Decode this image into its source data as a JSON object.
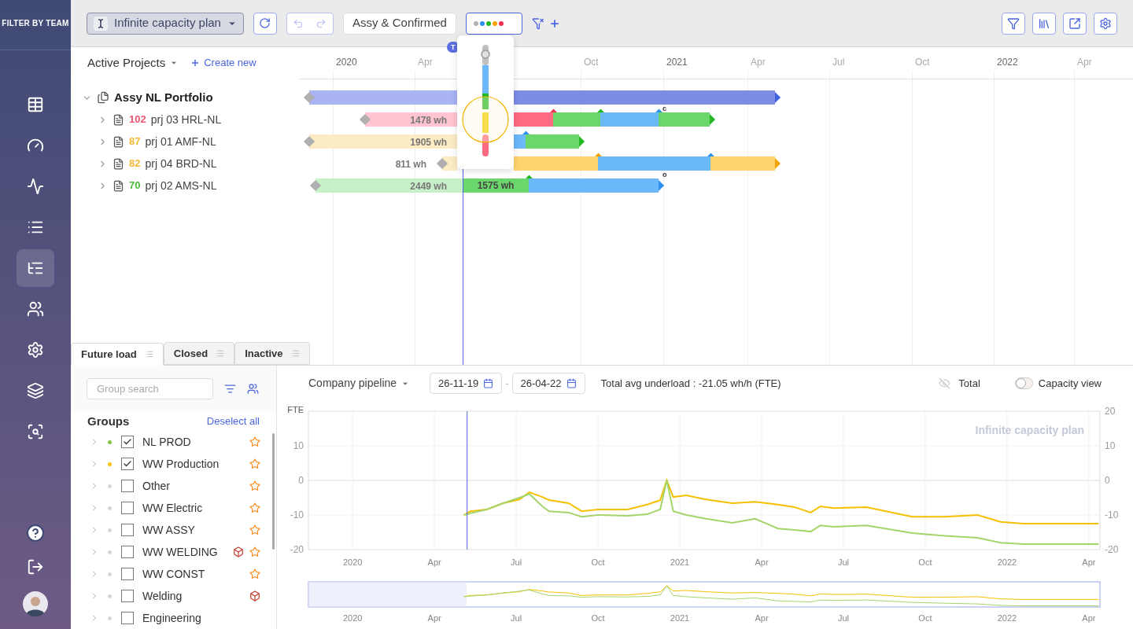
{
  "sidebar": {
    "title": "FILTER BY TEAM",
    "items": [
      {
        "kind": "table",
        "selected": false
      },
      {
        "kind": "gauge",
        "selected": false
      },
      {
        "kind": "activity",
        "selected": false
      },
      {
        "kind": "list",
        "selected": false
      },
      {
        "kind": "gantt",
        "selected": true
      },
      {
        "kind": "users",
        "selected": false
      },
      {
        "kind": "settings",
        "selected": false
      },
      {
        "kind": "layers",
        "selected": false
      },
      {
        "kind": "analysis",
        "selected": false
      }
    ],
    "bottom": [
      {
        "kind": "help"
      },
      {
        "kind": "logout"
      },
      {
        "kind": "avatar"
      }
    ]
  },
  "toolbar": {
    "plan": "Infinite capacity plan",
    "filter": "Assy & Confirmed",
    "status_dots": [
      {
        "color": "#b0b0b0"
      },
      {
        "color": "#2f8ff0"
      },
      {
        "color": "#22b822"
      },
      {
        "color": "#f5a300"
      },
      {
        "color": "#f0304f"
      }
    ],
    "undo_disabled": true,
    "redo_disabled": true
  },
  "gantt": {
    "view": "Active Projects",
    "create": "Create new",
    "today_badge": "T",
    "timeline": [
      {
        "label": "2020",
        "kind": "year"
      },
      {
        "label": "Apr",
        "kind": "month"
      },
      {
        "label": "Oct",
        "kind": "month"
      },
      {
        "label": "2021",
        "kind": "year"
      },
      {
        "label": "Apr",
        "kind": "month"
      },
      {
        "label": "Jul",
        "kind": "month"
      },
      {
        "label": "Oct",
        "kind": "month"
      },
      {
        "label": "2022",
        "kind": "year"
      },
      {
        "label": "Apr",
        "kind": "month"
      }
    ],
    "rows": [
      {
        "kind": "portfolio",
        "name": "Assy NL Portfolio",
        "expanded": true,
        "segments": [
          {
            "color": "#aab3f4"
          },
          {
            "color": "#7d8de6",
            "milestone": {
              "color": "#3f63e0"
            }
          }
        ]
      },
      {
        "kind": "project",
        "score": "102",
        "color": "#f2546e",
        "name": "prj 03 HRL-NL",
        "expanded": false,
        "load": "1478 wh",
        "segments": [
          {
            "color": "#ffc4cf"
          },
          {
            "color": "#ff6b81",
            "milestone": {
              "color": "#f0304f"
            }
          },
          {
            "color": "#6bd66b",
            "milestone": {
              "color": "#22b822"
            }
          },
          {
            "color": "#6bb8fa",
            "milestone": {
              "color": "#2f8ff0"
            },
            "note": "c"
          },
          {
            "color": "#6bd66b",
            "milestone": {
              "color": "#22b822"
            }
          }
        ]
      },
      {
        "kind": "project",
        "score": "87",
        "color": "#f5b935",
        "name": "prj 01 AMF-NL",
        "expanded": false,
        "load": "1905 wh",
        "segments": [
          {
            "color": "#fdebc4"
          },
          {
            "color": "#6bb8fa",
            "milestone": {
              "color": "#2f8ff0"
            }
          },
          {
            "color": "#6bd66b",
            "milestone": {
              "color": "#22b822"
            }
          }
        ]
      },
      {
        "kind": "project",
        "score": "82",
        "color": "#f5b935",
        "name": "prj 04 BRD-NL",
        "expanded": false,
        "load": "811 wh",
        "segments": [
          {
            "color": "#fdebc4"
          },
          {
            "color": "#fdd36b",
            "milestone": {
              "color": "#f5a300"
            }
          },
          {
            "color": "#6bb8fa",
            "milestone": {
              "color": "#2f8ff0"
            }
          },
          {
            "color": "#fdd36b",
            "milestone": {
              "color": "#f5a300"
            }
          }
        ]
      },
      {
        "kind": "project",
        "score": "70",
        "color": "#4cbb3c",
        "name": "prj 02 AMS-NL",
        "expanded": false,
        "load": "2449 wh",
        "segments": [
          {
            "color": "#c8f0c8"
          },
          {
            "color": "#6bd66b",
            "milestone": {
              "color": "#22b822"
            },
            "label": "1575 wh"
          },
          {
            "color": "#6bb8fa",
            "milestone": {
              "color": "#2f8ff0"
            },
            "note": "o"
          }
        ]
      }
    ],
    "tabs": [
      {
        "label": "Future load",
        "selected": true
      },
      {
        "label": "Closed",
        "selected": false
      },
      {
        "label": "Inactive",
        "selected": false
      }
    ]
  },
  "groups": {
    "search_placeholder": "Group search",
    "title": "Groups",
    "deselect": "Deselect all",
    "items": [
      {
        "name": "NL PROD",
        "color": "#8bc34a",
        "checked": true,
        "cube": false,
        "starred": true
      },
      {
        "name": "WW Production",
        "color": "#ffc107",
        "checked": true,
        "cube": false,
        "starred": true
      },
      {
        "name": "Other",
        "color": "#d6d6d6",
        "checked": false,
        "cube": false,
        "starred": true
      },
      {
        "name": "WW Electric",
        "color": "#d6d6d6",
        "checked": false,
        "cube": false,
        "starred": true
      },
      {
        "name": "WW ASSY",
        "color": "#d6d6d6",
        "checked": false,
        "cube": false,
        "starred": true
      },
      {
        "name": "WW WELDING",
        "color": "#d6d6d6",
        "checked": false,
        "cube": true,
        "starred": true
      },
      {
        "name": "WW CONST",
        "color": "#d6d6d6",
        "checked": false,
        "cube": false,
        "starred": true
      },
      {
        "name": "Welding",
        "color": "#d6d6d6",
        "checked": false,
        "cube": true,
        "starred": false
      },
      {
        "name": "Engineering",
        "color": "#d6d6d6",
        "checked": false,
        "cube": false,
        "starred": false
      }
    ]
  },
  "load": {
    "pipeline": "Company pipeline",
    "date_from": "26-11-19",
    "date_sep": "-",
    "date_to": "26-04-22",
    "summary": "Total avg underload : -21.05 wh/h (FTE)",
    "total": {
      "label": "Total",
      "visible": false
    },
    "capacity_view": {
      "label": "Capacity view",
      "on": false
    },
    "chart_data": {
      "type": "line",
      "title": "Infinite capacity plan",
      "ylabel": "FTE",
      "x": [
        2020.34,
        2020.36,
        2020.41,
        2020.46,
        2020.51,
        2020.54,
        2020.58,
        2020.6,
        2020.66,
        2020.7,
        2020.75,
        2020.84,
        2020.9,
        2020.94,
        2020.96,
        2020.98,
        2021.02,
        2021.08,
        2021.16,
        2021.23,
        2021.3,
        2021.35,
        2021.4,
        2021.43,
        2021.47,
        2021.57,
        2021.71,
        2021.81,
        2021.91,
        2021.98,
        2022.05,
        2022.28
      ],
      "series": [
        {
          "color": "#f5c000",
          "values": [
            -10,
            -8.9,
            -8.4,
            -6.6,
            -5.5,
            -3.4,
            -4.8,
            -5.7,
            -6.6,
            -8.9,
            -8.4,
            -8.4,
            -7,
            -5.7,
            0,
            -4.8,
            -4.3,
            -5.5,
            -6.6,
            -6.2,
            -7,
            -7.7,
            -9.3,
            -7.5,
            -8,
            -7.7,
            -10.5,
            -10.5,
            -10,
            -12,
            -12.5,
            -12.5
          ]
        },
        {
          "color": "#a5d46a",
          "values": [
            -10,
            -9.5,
            -8.4,
            -6.6,
            -5,
            -3.9,
            -7.5,
            -8.9,
            -9.3,
            -10.5,
            -10,
            -10.2,
            -9.8,
            -8.4,
            0,
            -8.9,
            -10,
            -11.1,
            -12.3,
            -11.1,
            -13.9,
            -14.3,
            -14.8,
            -13,
            -13.4,
            -13,
            -15.2,
            -16,
            -16.6,
            -18,
            -18.4,
            -18.4
          ]
        }
      ],
      "xlim": [
        2019.865,
        2022.284
      ],
      "ylim": [
        -20,
        20
      ],
      "xticks": [
        {
          "value": 2020,
          "label": "2020"
        },
        {
          "value": 2020.25,
          "label": "Apr"
        },
        {
          "value": 2020.5,
          "label": "Jul"
        },
        {
          "value": 2020.75,
          "label": "Oct"
        },
        {
          "value": 2021,
          "label": "2021"
        },
        {
          "value": 2021.25,
          "label": "Apr"
        },
        {
          "value": 2021.5,
          "label": "Jul"
        },
        {
          "value": 2021.75,
          "label": "Oct"
        },
        {
          "value": 2022,
          "label": "2022"
        },
        {
          "value": 2022.25,
          "label": "Apr"
        }
      ],
      "yticks": [
        -20,
        -10,
        0,
        10,
        20
      ],
      "grid": true,
      "ref_lines": [
        {
          "axis": "x",
          "value": 2020.35,
          "color": "#4a66e0"
        }
      ]
    },
    "left_axis_labels": [
      "10",
      "0",
      "-10",
      "-20"
    ],
    "right_axis_labels": [
      "20",
      "10",
      "0",
      "-10",
      "-20"
    ],
    "navigator": {
      "labels": [
        "2020",
        "Apr",
        "Jul",
        "Oct",
        "2021",
        "Apr",
        "Jul",
        "Oct",
        "2022",
        "Apr"
      ]
    }
  }
}
